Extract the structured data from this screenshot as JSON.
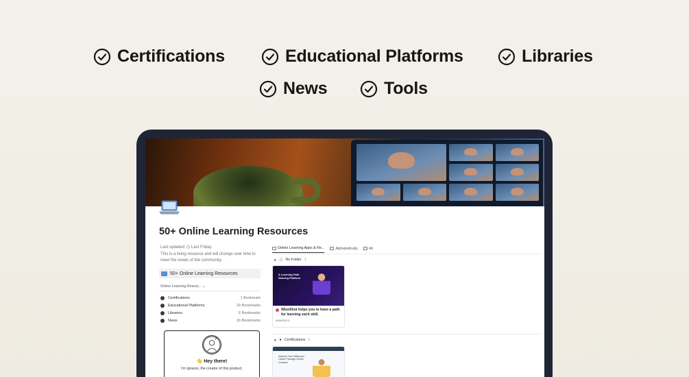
{
  "features": [
    {
      "label": "Certifications"
    },
    {
      "label": "Educational Platforms"
    },
    {
      "label": "Libraries"
    },
    {
      "label": "News"
    },
    {
      "label": "Tools"
    }
  ],
  "page": {
    "icon": "laptop-icon",
    "title": "50+ Online Learning Resources",
    "last_updated": "Last updated: ◷ Last Friday",
    "description": "This is a living resource and will change over time to meet the needs of the community.",
    "callout": "50+ Online Learning Resources"
  },
  "database": {
    "view_tab": "Online Learning Resour... ⌄",
    "items": [
      {
        "name": "Certifications",
        "count": "1 Bookmark"
      },
      {
        "name": "Educational Platforms",
        "count": "29 Bookmarks"
      },
      {
        "name": "Libraries",
        "count": "6 Bookmarks"
      },
      {
        "name": "News",
        "count": "16 Bookmarks"
      }
    ]
  },
  "greeting": {
    "title": "Hey there!",
    "subtitle": "I'm Ignacio, the creator of this product."
  },
  "board": {
    "tabs": [
      "Online Learning Apps & Re...",
      "Alphabetically",
      "All"
    ],
    "groups": [
      {
        "name": "No Folder",
        "count": "1"
      },
      {
        "name": "Certifications",
        "count": "1"
      }
    ],
    "card": {
      "thumb_text": "A Learning Path Sharing Platform",
      "title": "WiseShot helps you to have a path for learning each skill.",
      "url": "wiseshot.io"
    },
    "card2": {
      "thumb_text": "Improve Your Skills and Career Through Online Courses"
    }
  },
  "colors": {
    "frame": "#1f2535",
    "accent": "#5a8fd3"
  }
}
